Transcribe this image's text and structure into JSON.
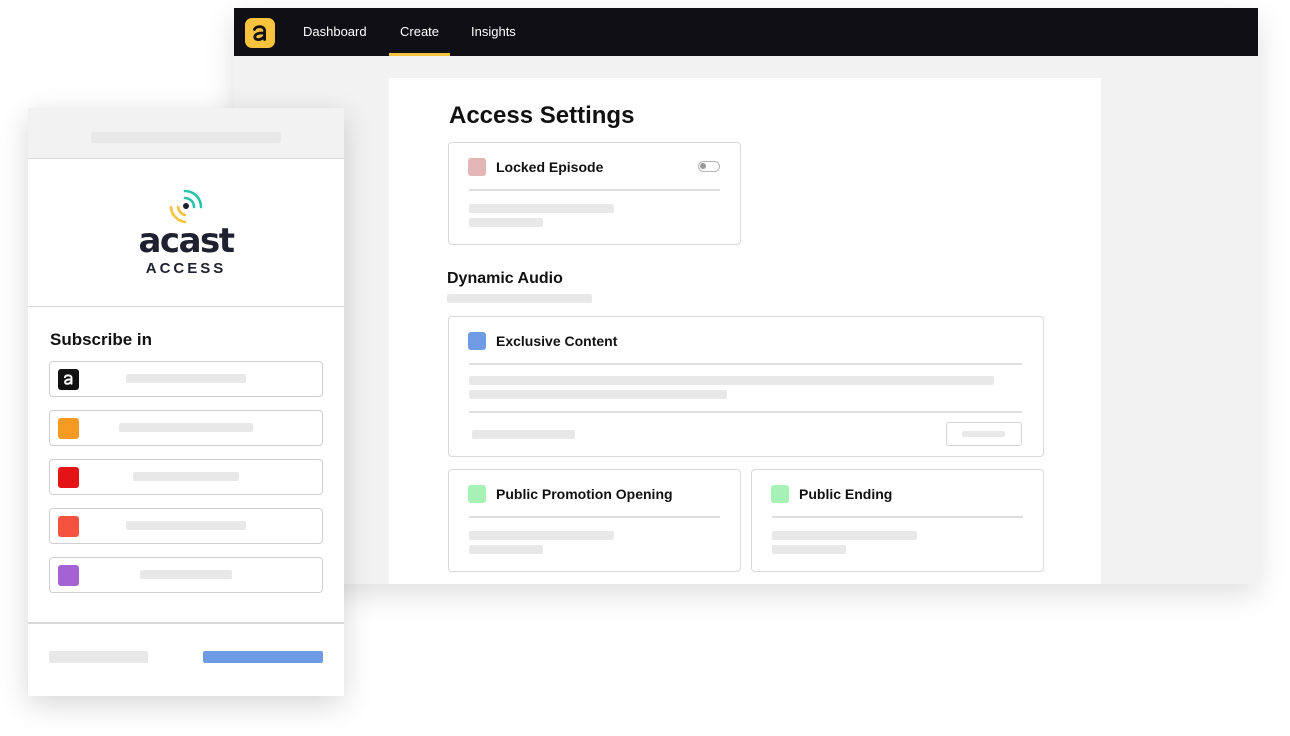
{
  "nav": {
    "items": [
      {
        "label": "Dashboard",
        "active": false
      },
      {
        "label": "Create",
        "active": true
      },
      {
        "label": "Insights",
        "active": false
      }
    ],
    "logo_icon": "acast-logo-icon",
    "accent_color": "#f7c33c"
  },
  "settings": {
    "title": "Access Settings",
    "locked_episode": {
      "label": "Locked Episode",
      "color": "#e4b5b5"
    },
    "dynamic_audio": {
      "title": "Dynamic Audio"
    },
    "exclusive_content": {
      "label": "Exclusive Content",
      "color": "#6f9be4"
    },
    "public_promotion_opening": {
      "label": "Public Promotion Opening",
      "color": "#a6f2b5"
    },
    "public_ending": {
      "label": "Public Ending",
      "color": "#a6f2b5"
    }
  },
  "mobile": {
    "brand": {
      "name": "acast",
      "tagline": "ACCESS"
    },
    "subscribe_title": "Subscribe in",
    "apps": [
      {
        "color": "#111111",
        "icon": "acast-app-icon"
      },
      {
        "color": "#f59b22",
        "icon": "app-icon"
      },
      {
        "color": "#e41316",
        "icon": "app-icon"
      },
      {
        "color": "#f4533f",
        "icon": "app-icon"
      },
      {
        "color": "#a462d2",
        "icon": "app-icon"
      }
    ],
    "primary_color": "#6f9be4"
  }
}
